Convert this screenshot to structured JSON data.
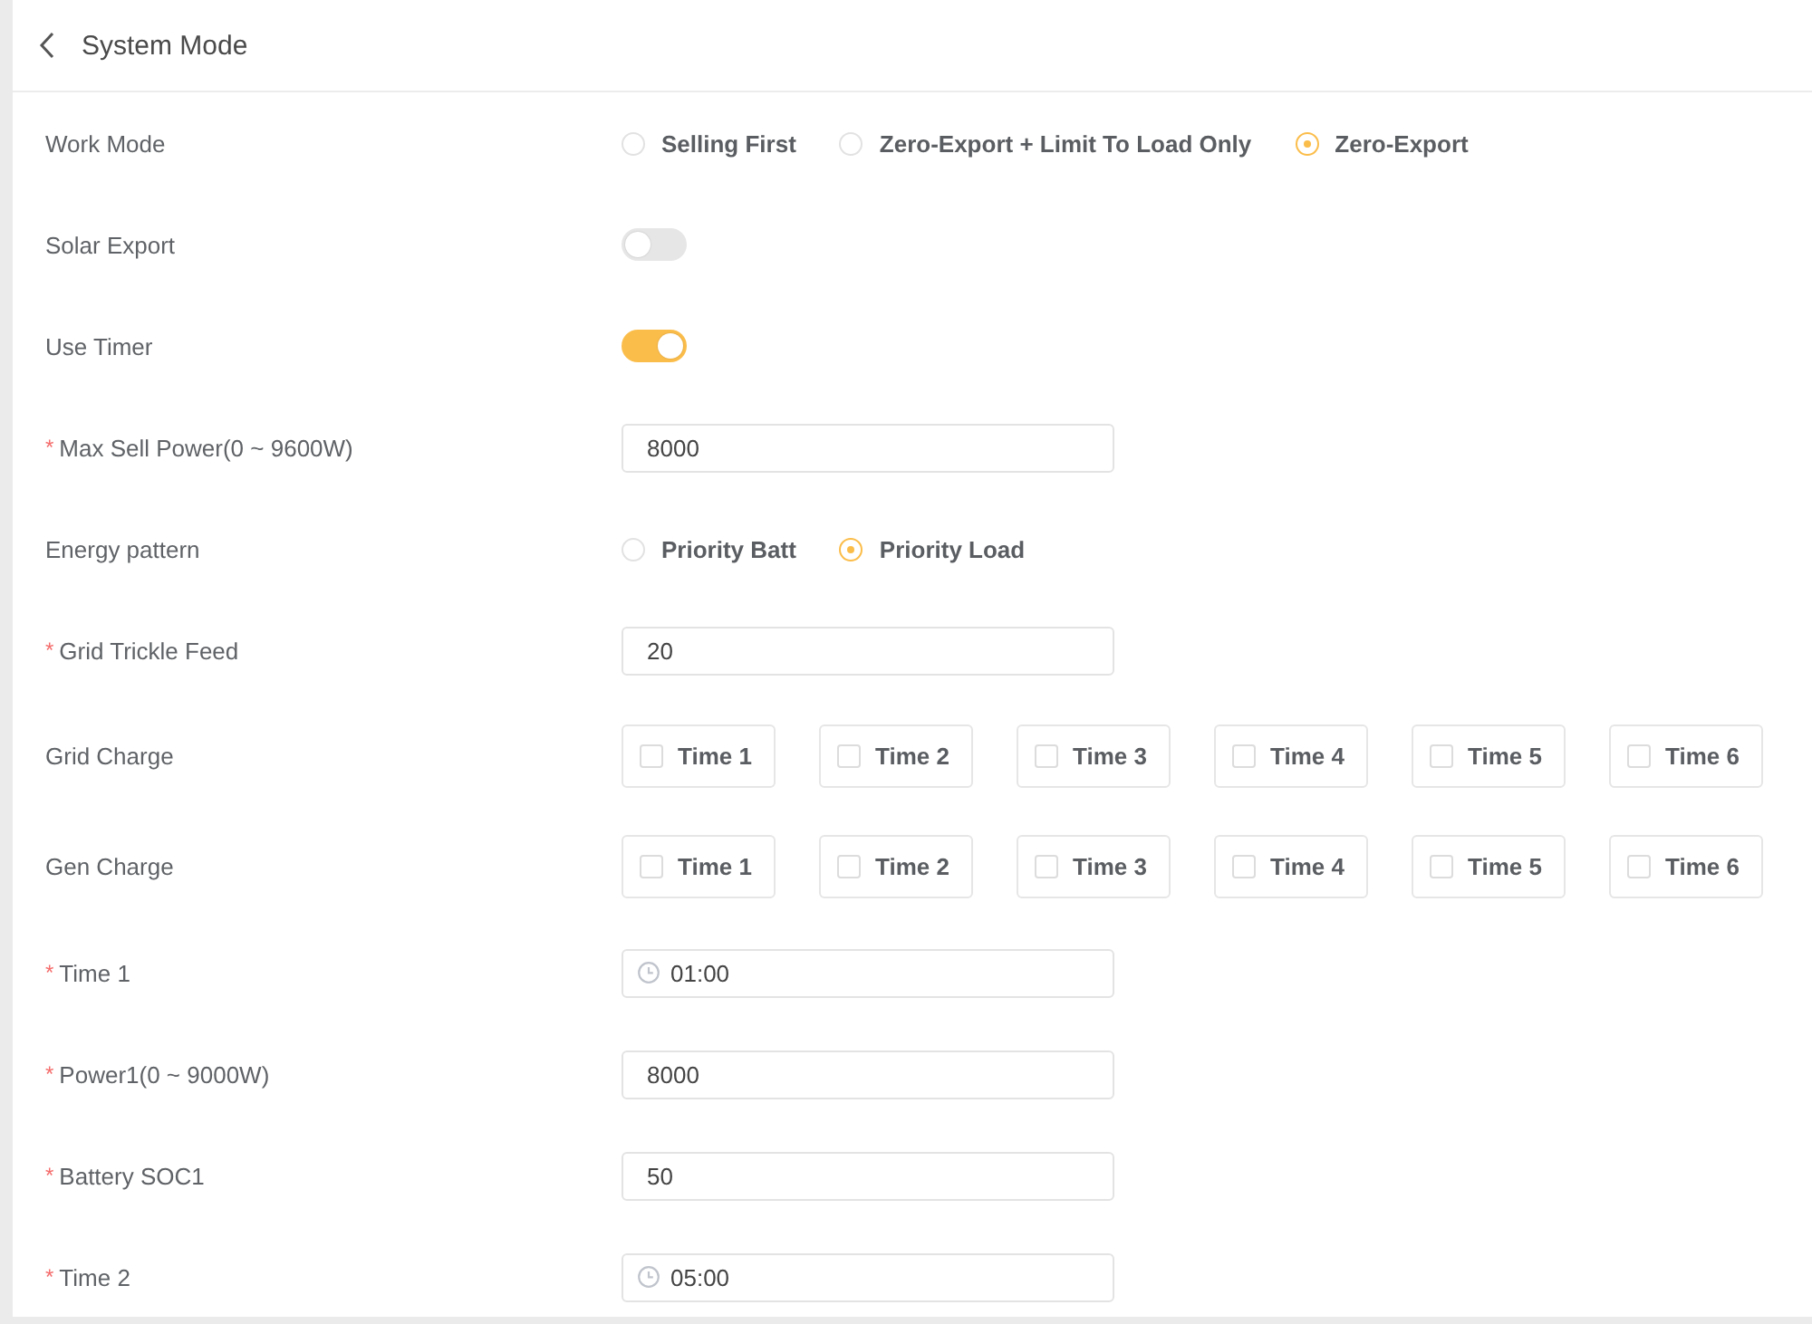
{
  "header": {
    "title": "System Mode"
  },
  "fields": [
    {
      "kind": "radio",
      "label": "Work Mode",
      "options": [
        {
          "label": "Selling First",
          "selected": false
        },
        {
          "label": "Zero-Export + Limit To Load Only",
          "selected": false
        },
        {
          "label": "Zero-Export",
          "selected": true
        }
      ]
    },
    {
      "kind": "switch",
      "label": "Solar Export",
      "on": false
    },
    {
      "kind": "switch",
      "label": "Use Timer",
      "on": true
    },
    {
      "kind": "input",
      "required_mark": "*",
      "label": "Max Sell Power(0 ~ 9600W)",
      "value": "8000"
    },
    {
      "kind": "radio",
      "label": "Energy pattern",
      "options": [
        {
          "label": "Priority Batt",
          "selected": false
        },
        {
          "label": "Priority Load",
          "selected": true
        }
      ]
    },
    {
      "kind": "input",
      "required_mark": "*",
      "label": "Grid Trickle Feed",
      "value": "20"
    },
    {
      "kind": "checkboxes",
      "label": "Grid Charge",
      "options": [
        {
          "label": "Time 1",
          "checked": false
        },
        {
          "label": "Time 2",
          "checked": false
        },
        {
          "label": "Time 3",
          "checked": false
        },
        {
          "label": "Time 4",
          "checked": false
        },
        {
          "label": "Time 5",
          "checked": false
        },
        {
          "label": "Time 6",
          "checked": false
        }
      ]
    },
    {
      "kind": "checkboxes",
      "label": "Gen Charge",
      "options": [
        {
          "label": "Time 1",
          "checked": false
        },
        {
          "label": "Time 2",
          "checked": false
        },
        {
          "label": "Time 3",
          "checked": false
        },
        {
          "label": "Time 4",
          "checked": false
        },
        {
          "label": "Time 5",
          "checked": false
        },
        {
          "label": "Time 6",
          "checked": false
        }
      ]
    },
    {
      "kind": "time",
      "required_mark": "*",
      "label": "Time 1",
      "value": "01:00"
    },
    {
      "kind": "input",
      "required_mark": "*",
      "label": "Power1(0 ~ 9000W)",
      "value": "8000"
    },
    {
      "kind": "input",
      "required_mark": "*",
      "label": "Battery SOC1",
      "value": "50"
    },
    {
      "kind": "time",
      "required_mark": "*",
      "label": "Time 2",
      "value": "05:00"
    }
  ]
}
